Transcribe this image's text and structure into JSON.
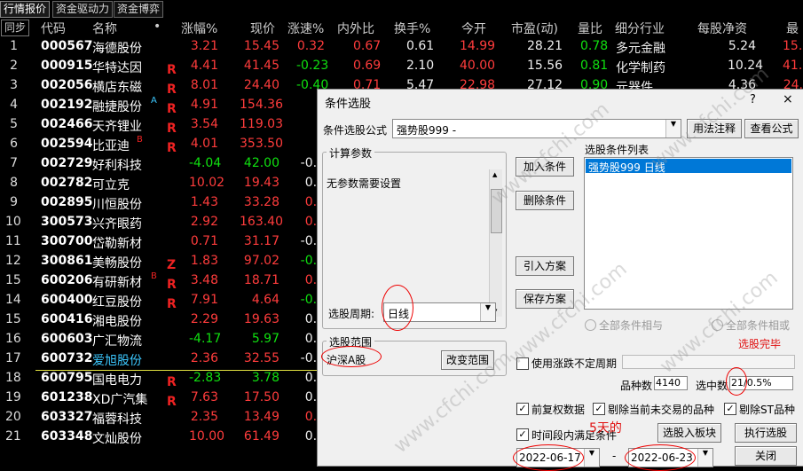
{
  "tabs": [
    "行情报价",
    "资金驱动力",
    "资金博弈"
  ],
  "sync_button": "同步",
  "columns": [
    "代码",
    "名称",
    "•",
    "涨幅%",
    "现价",
    "涨速%",
    "内外比",
    "换手%",
    "今开",
    "市盈(动)",
    "量比",
    "细分行业",
    "每股净资",
    "最"
  ],
  "rows": [
    {
      "idx": "1",
      "code": "000567",
      "name": "海德股份",
      "mark": "",
      "sup": "",
      "chg": "3.21",
      "price": "15.45",
      "speed": "0.32",
      "ratio": "0.67",
      "turnover": "0.61",
      "open": "14.99",
      "pe": "28.21",
      "vol": "0.78",
      "industry": "多元金融",
      "nav": "5.24",
      "last": "15.5"
    },
    {
      "idx": "2",
      "code": "000915",
      "name": "华特达因",
      "mark": "R",
      "sup": "",
      "chg": "4.41",
      "price": "41.45",
      "speed": "-0.23",
      "ratio": "0.69",
      "turnover": "2.10",
      "open": "40.00",
      "pe": "15.56",
      "vol": "0.81",
      "industry": "化学制药",
      "nav": "10.24",
      "last": "41.9"
    },
    {
      "idx": "3",
      "code": "002056",
      "name": "横店东磁",
      "mark": "R",
      "sup": "",
      "chg": "8.01",
      "price": "24.40",
      "speed": "-0.40",
      "ratio": "0.71",
      "turnover": "5.47",
      "open": "22.98",
      "pe": "27.12",
      "vol": "0.90",
      "industry": "元器件",
      "nav": "4.36",
      "last": "24."
    },
    {
      "idx": "4",
      "code": "002192",
      "name": "融捷股份",
      "mark": "R",
      "sup": "A",
      "chg": "4.91",
      "price": "154.36",
      "speed": "",
      "ratio": "",
      "turnover": "",
      "open": "",
      "pe": "",
      "vol": "",
      "industry": "",
      "nav": "",
      "last": ""
    },
    {
      "idx": "5",
      "code": "002466",
      "name": "天齐锂业",
      "mark": "R",
      "sup": "",
      "chg": "3.54",
      "price": "119.03",
      "speed": "",
      "ratio": "",
      "turnover": "",
      "open": "",
      "pe": "",
      "vol": "",
      "industry": "",
      "nav": "",
      "last": ""
    },
    {
      "idx": "6",
      "code": "002594",
      "name": "比亚迪",
      "mark": "R",
      "sup": "B",
      "chg": "4.01",
      "price": "353.50",
      "speed": "",
      "ratio": "",
      "turnover": "",
      "open": "",
      "pe": "",
      "vol": "",
      "industry": "",
      "nav": "",
      "last": ""
    },
    {
      "idx": "7",
      "code": "002729",
      "name": "好利科技",
      "mark": "",
      "sup": "",
      "chg": "-4.04",
      "price": "42.00",
      "speed": "-0.0",
      "ratio": "",
      "turnover": "",
      "open": "",
      "pe": "",
      "vol": "",
      "industry": "",
      "nav": "",
      "last": ""
    },
    {
      "idx": "8",
      "code": "002782",
      "name": "可立克",
      "mark": "",
      "sup": "",
      "chg": "10.02",
      "price": "19.43",
      "speed": "0.0",
      "ratio": "",
      "turnover": "",
      "open": "",
      "pe": "",
      "vol": "",
      "industry": "",
      "nav": "",
      "last": ""
    },
    {
      "idx": "9",
      "code": "002895",
      "name": "川恒股份",
      "mark": "",
      "sup": "",
      "chg": "1.43",
      "price": "33.28",
      "speed": "0.2",
      "ratio": "",
      "turnover": "",
      "open": "",
      "pe": "",
      "vol": "",
      "industry": "",
      "nav": "",
      "last": ""
    },
    {
      "idx": "10",
      "code": "300573",
      "name": "兴齐眼药",
      "mark": "",
      "sup": "",
      "chg": "2.92",
      "price": "163.40",
      "speed": "0.1",
      "ratio": "",
      "turnover": "",
      "open": "",
      "pe": "",
      "vol": "",
      "industry": "",
      "nav": "",
      "last": ""
    },
    {
      "idx": "11",
      "code": "300700",
      "name": "岱勒新材",
      "mark": "",
      "sup": "",
      "chg": "0.71",
      "price": "31.17",
      "speed": "-0.0",
      "ratio": "",
      "turnover": "",
      "open": "",
      "pe": "",
      "vol": "",
      "industry": "",
      "nav": "",
      "last": ""
    },
    {
      "idx": "12",
      "code": "300861",
      "name": "美畅股份",
      "mark": "Z",
      "sup": "",
      "chg": "1.83",
      "price": "97.02",
      "speed": "-0.3",
      "ratio": "",
      "turnover": "",
      "open": "",
      "pe": "",
      "vol": "",
      "industry": "",
      "nav": "",
      "last": ""
    },
    {
      "idx": "15",
      "code": "600206",
      "name": "有研新材",
      "mark": "R",
      "sup": "B",
      "chg": "3.48",
      "price": "18.71",
      "speed": "0.1",
      "ratio": "",
      "turnover": "",
      "open": "",
      "pe": "",
      "vol": "",
      "industry": "",
      "nav": "",
      "last": ""
    },
    {
      "idx": "14",
      "code": "600400",
      "name": "红豆股份",
      "mark": "R",
      "sup": "",
      "chg": "7.91",
      "price": "4.64",
      "speed": "-0.2",
      "ratio": "",
      "turnover": "",
      "open": "",
      "pe": "",
      "vol": "",
      "industry": "",
      "nav": "",
      "last": ""
    },
    {
      "idx": "15",
      "code": "600416",
      "name": "湘电股份",
      "mark": "",
      "sup": "",
      "chg": "2.29",
      "price": "19.63",
      "speed": "0.0",
      "ratio": "",
      "turnover": "",
      "open": "",
      "pe": "",
      "vol": "",
      "industry": "",
      "nav": "",
      "last": ""
    },
    {
      "idx": "16",
      "code": "600603",
      "name": "广汇物流",
      "mark": "",
      "sup": "",
      "chg": "-4.17",
      "price": "5.97",
      "speed": "0.0",
      "ratio": "",
      "turnover": "",
      "open": "",
      "pe": "",
      "vol": "",
      "industry": "",
      "nav": "",
      "last": ""
    },
    {
      "idx": "17",
      "code": "600732",
      "name": "爱旭股份",
      "mark": "",
      "sup": "",
      "chg": "2.36",
      "price": "32.55",
      "speed": "-0.0",
      "ratio": "",
      "turnover": "",
      "open": "",
      "pe": "",
      "vol": "",
      "industry": "",
      "nav": "",
      "last": ""
    },
    {
      "idx": "18",
      "code": "600795",
      "name": "国电电力",
      "mark": "R",
      "sup": "",
      "chg": "-2.83",
      "price": "3.78",
      "speed": "0.0",
      "ratio": "",
      "turnover": "",
      "open": "",
      "pe": "",
      "vol": "",
      "industry": "",
      "nav": "",
      "last": ""
    },
    {
      "idx": "19",
      "code": "601238",
      "name": "XD广汽集",
      "mark": "R",
      "sup": "",
      "chg": "7.63",
      "price": "17.50",
      "speed": "0.0",
      "ratio": "",
      "turnover": "",
      "open": "",
      "pe": "",
      "vol": "",
      "industry": "",
      "nav": "",
      "last": ""
    },
    {
      "idx": "20",
      "code": "603327",
      "name": "福蓉科技",
      "mark": "",
      "sup": "",
      "chg": "2.35",
      "price": "13.49",
      "speed": "0.3",
      "ratio": "",
      "turnover": "",
      "open": "",
      "pe": "",
      "vol": "",
      "industry": "",
      "nav": "",
      "last": ""
    },
    {
      "idx": "21",
      "code": "603348",
      "name": "文灿股份",
      "mark": "",
      "sup": "",
      "chg": "10.00",
      "price": "61.49",
      "speed": "0.0",
      "ratio": "",
      "turnover": "",
      "open": "",
      "pe": "",
      "vol": "",
      "industry": "",
      "nav": "",
      "last": ""
    }
  ],
  "dialog": {
    "title": "条件选股",
    "help": "?",
    "close": "×",
    "formula_label": "条件选股公式",
    "formula_value": "强势股999  -",
    "btn_usage": "用法注释",
    "btn_view_formula": "查看公式",
    "calc_group": "计算参数",
    "no_params": "无参数需要设置",
    "btn_add": "加入条件",
    "btn_delete": "删除条件",
    "btn_import": "引入方案",
    "btn_save": "保存方案",
    "cond_list_label": "选股条件列表",
    "cond_list_item": "强势股999  日线",
    "period_label": "选股周期:",
    "period_value": "日线",
    "radio_and": "全部条件相与",
    "radio_or": "全部条件相或",
    "status_done": "选股完毕",
    "scope_group": "选股范围",
    "scope_value": "沪深A股",
    "btn_change_scope": "改变范围",
    "use_uncertain_label": "使用涨跌不定周期",
    "total_label": "品种数",
    "total_value": "4140",
    "selected_label": "选中数",
    "selected_value": "21/0.5%",
    "chk_restore": "前复权数据",
    "chk_exclude_untraded": "剔除当前未交易的品种",
    "chk_exclude_st": "剔除ST品种",
    "chk_period_satisfy": "时间段内满足条件",
    "btn_to_block": "选股入板块",
    "btn_execute": "执行选股",
    "annotation_days": "5天的",
    "date_from": "2022-06-17",
    "date_sep": "-",
    "date_to": "2022-06-23",
    "btn_close": "关闭"
  },
  "watermark": "www.cfchi.com"
}
